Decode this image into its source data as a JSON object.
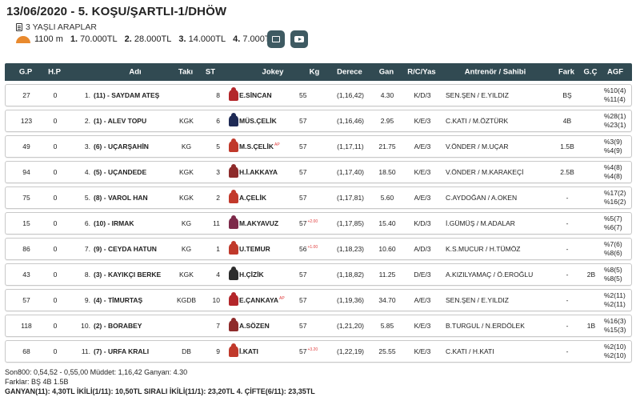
{
  "race": {
    "title": "13/06/2020 - 5. KOŞU/ŞARTLI-1/DHÖW",
    "subtitle": "3 YAŞLI ARAPLAR",
    "distance": "1100 m",
    "prizes": [
      {
        "rank": "1.",
        "amount": "70.000TL"
      },
      {
        "rank": "2.",
        "amount": "28.000TL"
      },
      {
        "rank": "3.",
        "amount": "14.000TL"
      },
      {
        "rank": "4.",
        "amount": "7.000TL"
      }
    ]
  },
  "columns": {
    "gp": "G.P",
    "hp": "H.P",
    "name": "Adı",
    "taki": "Takı",
    "st": "ST",
    "jokey": "Jokey",
    "kg": "Kg",
    "derece": "Derece",
    "gan": "Gan",
    "rc": "R/C/Yas",
    "ant": "Antrenör / Sahibi",
    "fark": "Fark",
    "gc": "G.Ç",
    "agf": "AGF"
  },
  "rows": [
    {
      "gp": "27",
      "hp": "0",
      "no": "1.",
      "name": "(11) - SAYDAM ATEŞ",
      "taki": "",
      "st": "8",
      "silk": "#b3262a",
      "jokey": "E.SİNCAN",
      "kg": "55",
      "kgsup": "",
      "derece": "(1,16,42)",
      "gan": "4.30",
      "rc": "K/D/3",
      "ant": "SEN.ŞEN / E.YILDIZ",
      "fark": "BŞ",
      "gc": "",
      "agf1": "%10(4)",
      "agf2": "%11(4)"
    },
    {
      "gp": "123",
      "hp": "0",
      "no": "2.",
      "name": "(1) - ALEV TOPU",
      "taki": "KGK",
      "st": "6",
      "silk": "#1e2a55",
      "jokey": "MÜS.ÇELİK",
      "kg": "57",
      "kgsup": "",
      "derece": "(1,16,46)",
      "gan": "2.95",
      "rc": "K/E/3",
      "ant": "C.KATI / M.ÖZTÜRK",
      "fark": "4B",
      "gc": "",
      "agf1": "%28(1)",
      "agf2": "%23(1)"
    },
    {
      "gp": "49",
      "hp": "0",
      "no": "3.",
      "name": "(6) - UÇARŞAHİN",
      "taki": "KG",
      "st": "5",
      "silk": "#c0392b",
      "jokey": "M.S.ÇELİK",
      "jokeysup": "AP",
      "kg": "57",
      "kgsup": "",
      "derece": "(1,17,11)",
      "gan": "21.75",
      "rc": "A/E/3",
      "ant": "V.ÖNDER / M.UÇAR",
      "fark": "1.5B",
      "gc": "",
      "agf1": "%3(9)",
      "agf2": "%4(9)"
    },
    {
      "gp": "94",
      "hp": "0",
      "no": "4.",
      "name": "(5) - UÇANDEDE",
      "taki": "KGK",
      "st": "3",
      "silk": "#8e2b2b",
      "jokey": "H.İ.AKKAYA",
      "kg": "57",
      "kgsup": "",
      "derece": "(1,17,40)",
      "gan": "18.50",
      "rc": "K/E/3",
      "ant": "V.ÖNDER / M.KARAKEÇİ",
      "fark": "2.5B",
      "gc": "",
      "agf1": "%4(8)",
      "agf2": "%4(8)"
    },
    {
      "gp": "75",
      "hp": "0",
      "no": "5.",
      "name": "(8) - VAROL HAN",
      "taki": "KGK",
      "st": "2",
      "silk": "#c2392b",
      "jokey": "A.ÇELİK",
      "kg": "57",
      "kgsup": "",
      "derece": "(1,17,81)",
      "gan": "5.60",
      "rc": "A/E/3",
      "ant": "C.AYDOĞAN / A.OKEN",
      "fark": "-",
      "gc": "",
      "agf1": "%17(2)",
      "agf2": "%16(2)"
    },
    {
      "gp": "15",
      "hp": "0",
      "no": "6.",
      "name": "(10) - IRMAK",
      "taki": "KG",
      "st": "11",
      "silk": "#7d2a4a",
      "jokey": "M.AKYAVUZ",
      "kg": "57",
      "kgsup": "+2.00",
      "derece": "(1,17,85)",
      "gan": "15.40",
      "rc": "K/D/3",
      "ant": "İ.GÜMÜŞ / M.ADALAR",
      "fark": "-",
      "gc": "",
      "agf1": "%5(7)",
      "agf2": "%6(7)"
    },
    {
      "gp": "86",
      "hp": "0",
      "no": "7.",
      "name": "(9) - CEYDA HATUN",
      "taki": "KG",
      "st": "1",
      "silk": "#c0392b",
      "jokey": "U.TEMUR",
      "kg": "56",
      "kgsup": "+1.00",
      "derece": "(1,18,23)",
      "gan": "10.60",
      "rc": "A/D/3",
      "ant": "K.S.MUCUR / H.TÜMÖZ",
      "fark": "-",
      "gc": "",
      "agf1": "%7(6)",
      "agf2": "%8(6)"
    },
    {
      "gp": "43",
      "hp": "0",
      "no": "8.",
      "name": "(3) - KAYIKÇI BERKE",
      "taki": "KGK",
      "st": "4",
      "silk": "#2c2c2c",
      "jokey": "H.ÇİZİK",
      "kg": "57",
      "kgsup": "",
      "derece": "(1,18,82)",
      "gan": "11.25",
      "rc": "D/E/3",
      "ant": "A.KIZILYAMAÇ / Ö.EROĞLU",
      "fark": "-",
      "gc": "2B",
      "agf1": "%8(5)",
      "agf2": "%8(5)"
    },
    {
      "gp": "57",
      "hp": "0",
      "no": "9.",
      "name": "(4) - TİMURTAŞ",
      "taki": "KGDB",
      "st": "10",
      "silk": "#b3262a",
      "jokey": "E.ÇANKAYA",
      "jokeysup": "AP",
      "kg": "57",
      "kgsup": "",
      "derece": "(1,19,36)",
      "gan": "34.70",
      "rc": "A/E/3",
      "ant": "SEN.ŞEN / E.YILDIZ",
      "fark": "-",
      "gc": "",
      "agf1": "%2(11)",
      "agf2": "%2(11)"
    },
    {
      "gp": "118",
      "hp": "0",
      "no": "10.",
      "name": "(2) - BORABEY",
      "taki": "",
      "st": "7",
      "silk": "#8e2b2b",
      "jokey": "A.SÖZEN",
      "kg": "57",
      "kgsup": "",
      "derece": "(1,21,20)",
      "gan": "5.85",
      "rc": "K/E/3",
      "ant": "B.TURGUL / N.ERDÖLEK",
      "fark": "-",
      "gc": "1B",
      "agf1": "%16(3)",
      "agf2": "%15(3)"
    },
    {
      "gp": "68",
      "hp": "0",
      "no": "11.",
      "name": "(7) - URFA KRALI",
      "taki": "DB",
      "st": "9",
      "silk": "#c0392b",
      "jokey": "İ.KATI",
      "kg": "57",
      "kgsup": "+3.20",
      "derece": "(1,22,19)",
      "gan": "25.55",
      "rc": "K/E/3",
      "ant": "C.KATI / H.KATI",
      "fark": "-",
      "gc": "",
      "agf1": "%2(10)",
      "agf2": "%2(10)"
    }
  ],
  "footer": {
    "line1": "Son800: 0,54,52 - 0,55,00 Müddet: 1,16,42 Ganyan: 4.30",
    "line2": "Farklar: BŞ 4B 1.5B",
    "line3": "GANYAN(11): 4,30TL İKİLİ(1/11): 10,50TL SIRALI İKİLİ(11/1): 23,20TL 4. ÇİFTE(6/11): 23,35TL"
  }
}
